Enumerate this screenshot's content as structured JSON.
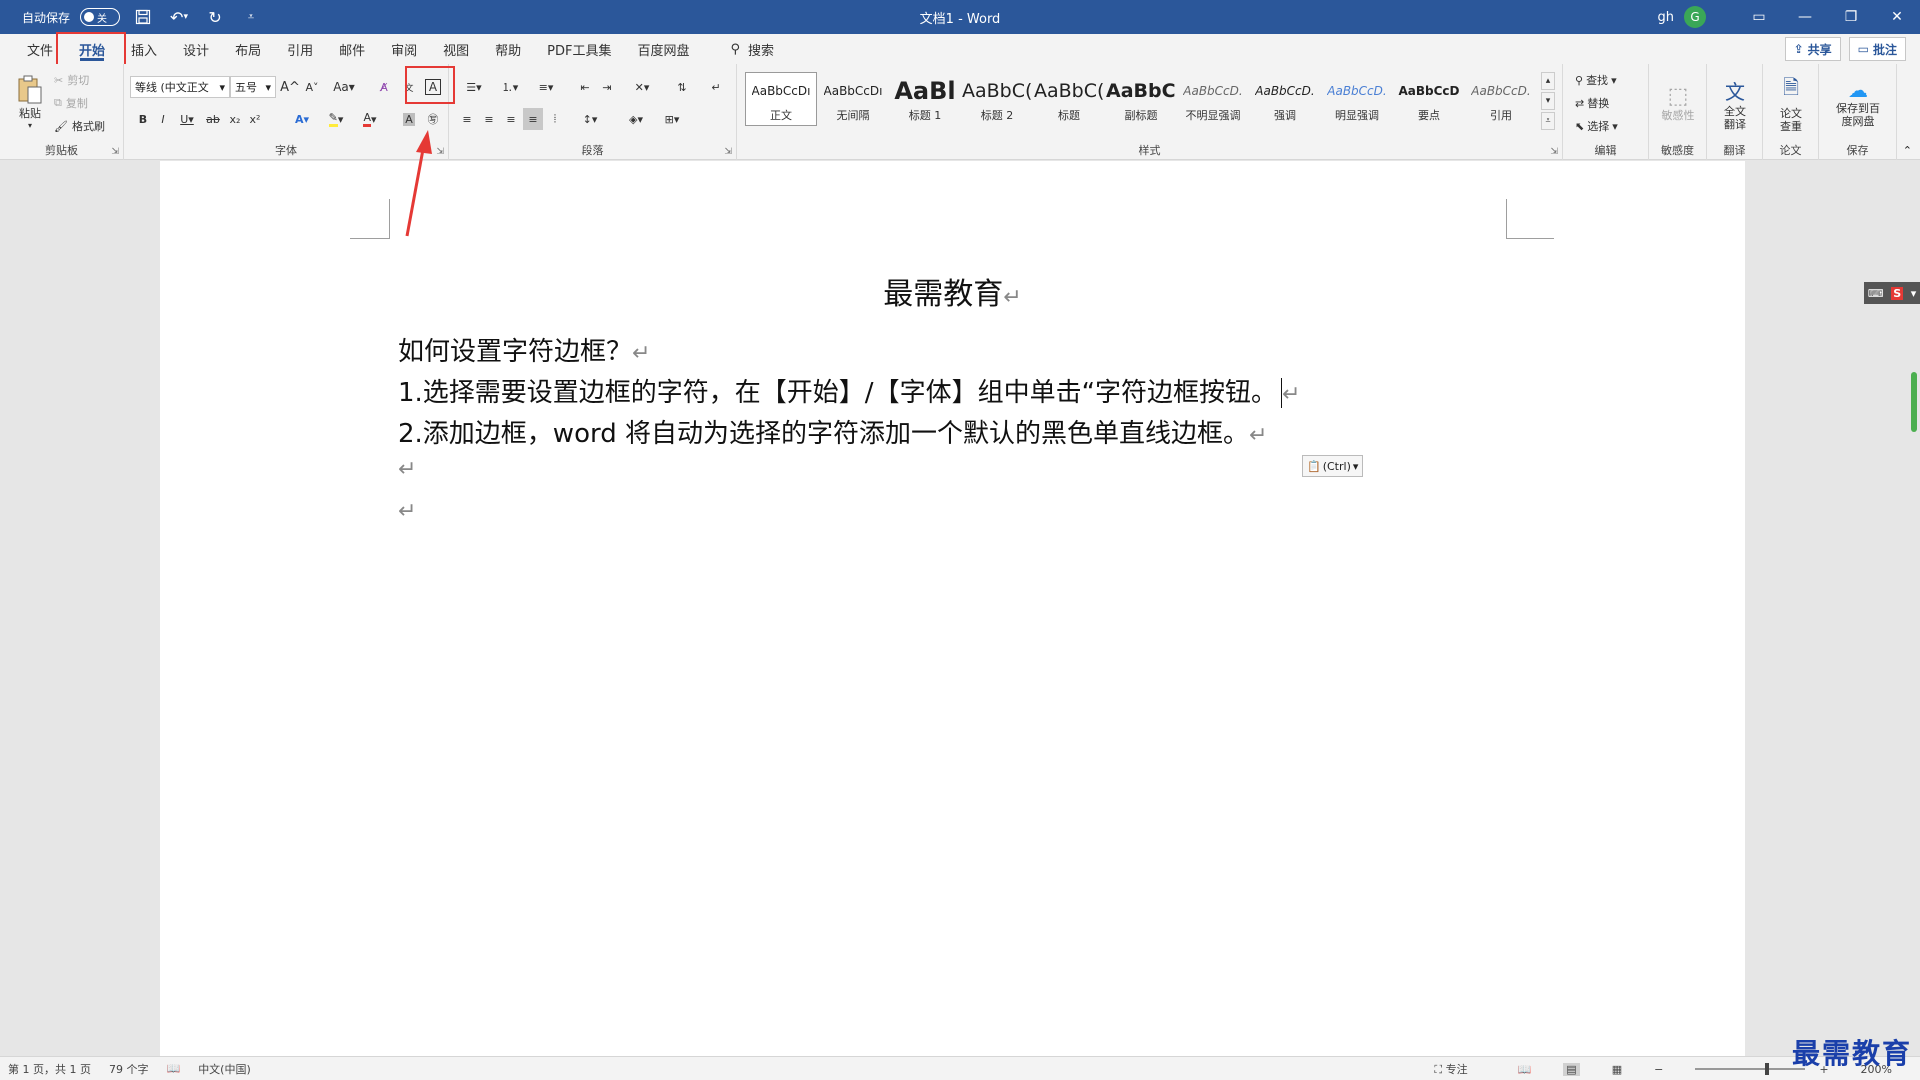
{
  "titlebar": {
    "autosave_label": "自动保存",
    "autosave_state": "关",
    "doc_title": "文档1 - Word",
    "user_name": "gh",
    "user_initial": "G"
  },
  "tabs": [
    "文件",
    "开始",
    "插入",
    "设计",
    "布局",
    "引用",
    "邮件",
    "审阅",
    "视图",
    "帮助",
    "PDF工具集",
    "百度网盘"
  ],
  "active_tab": "开始",
  "search_label": "搜索",
  "share_label": "共享",
  "comments_label": "批注",
  "clipboard": {
    "paste": "粘贴",
    "cut": "剪切",
    "copy": "复制",
    "format_painter": "格式刷",
    "label": "剪贴板"
  },
  "font": {
    "font_name": "等线 (中文正文",
    "font_size": "五号",
    "label": "字体",
    "change_case": "Aa"
  },
  "paragraph": {
    "label": "段落"
  },
  "styles": {
    "label": "样式",
    "items": [
      {
        "sample": "AaBbCcDı",
        "name": "正文"
      },
      {
        "sample": "AaBbCcDı",
        "name": "无间隔"
      },
      {
        "sample": "AaBl",
        "name": "标题 1"
      },
      {
        "sample": "AaBbC(",
        "name": "标题 2"
      },
      {
        "sample": "AaBbC(",
        "name": "标题"
      },
      {
        "sample": "AaBbC(",
        "name": "副标题"
      },
      {
        "sample": "AaBbCcD.",
        "name": "不明显强调"
      },
      {
        "sample": "AaBbCcD.",
        "name": "强调"
      },
      {
        "sample": "AaBbCcD.",
        "name": "明显强调"
      },
      {
        "sample": "AaBbCcD",
        "name": "要点"
      },
      {
        "sample": "AaBbCcD.",
        "name": "引用"
      }
    ]
  },
  "editing": {
    "find": "查找",
    "replace": "替换",
    "select": "选择",
    "label": "编辑"
  },
  "sensitivity": {
    "button": "敏感性",
    "label": "敏感度"
  },
  "translate": {
    "button": "全文翻译",
    "label": "翻译"
  },
  "paper": {
    "button": "论文查重",
    "label": "论文"
  },
  "save": {
    "button": "保存到百度网盘",
    "label": "保存"
  },
  "document": {
    "title": "最需教育",
    "lines": [
      "如何设置字符边框？",
      "1.选择需要设置边框的字符，在【开始】/【字体】组中单击“字符边框按钮。",
      "2.添加边框，word 将自动为选择的字符添加一个默认的黑色单直线边框。"
    ],
    "paste_options": "(Ctrl)"
  },
  "statusbar": {
    "page": "第 1 页，共 1 页",
    "word_count": "79 个字",
    "language": "中文(中国)",
    "focus": "专注",
    "zoom": "200%"
  },
  "watermark": "最需教育",
  "colors": {
    "titlebar": "#2b579a",
    "highlight": "#e53935",
    "arrow": "#e53935"
  }
}
